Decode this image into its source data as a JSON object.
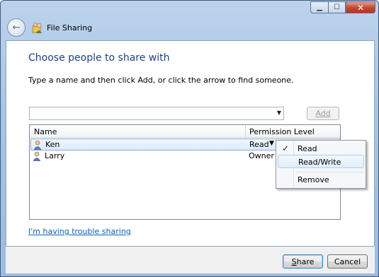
{
  "window": {
    "title": "File Sharing",
    "controls": {
      "minimize": "▁",
      "maximize": "☐",
      "close": "✕"
    }
  },
  "nav": {
    "back_icon": "back-arrow-icon",
    "back_glyph": "←"
  },
  "page": {
    "heading": "Choose people to share with",
    "instruction": "Type a name and then click Add, or click the arrow to find someone."
  },
  "name_input": {
    "value": "",
    "placeholder": ""
  },
  "add_button": {
    "label": "Add",
    "enabled": false
  },
  "list": {
    "columns": [
      "Name",
      "Permission Level"
    ],
    "rows": [
      {
        "name": "Ken",
        "permission": "Read",
        "selected": true
      },
      {
        "name": "Larry",
        "permission": "Owner",
        "selected": false
      }
    ]
  },
  "permission_menu": {
    "items": [
      {
        "label": "Read",
        "checked": true,
        "highlighted": false
      },
      {
        "label": "Read/Write",
        "checked": false,
        "highlighted": true
      },
      {
        "label": "Remove",
        "checked": false,
        "highlighted": false
      }
    ]
  },
  "help_link": "I'm having trouble sharing",
  "buttons": {
    "share": {
      "pre": "",
      "accel": "S",
      "post": "hare"
    },
    "cancel": "Cancel"
  },
  "colors": {
    "heading": "#1e3f87",
    "link": "#0a5fb8",
    "selection": "#dcebfc"
  }
}
